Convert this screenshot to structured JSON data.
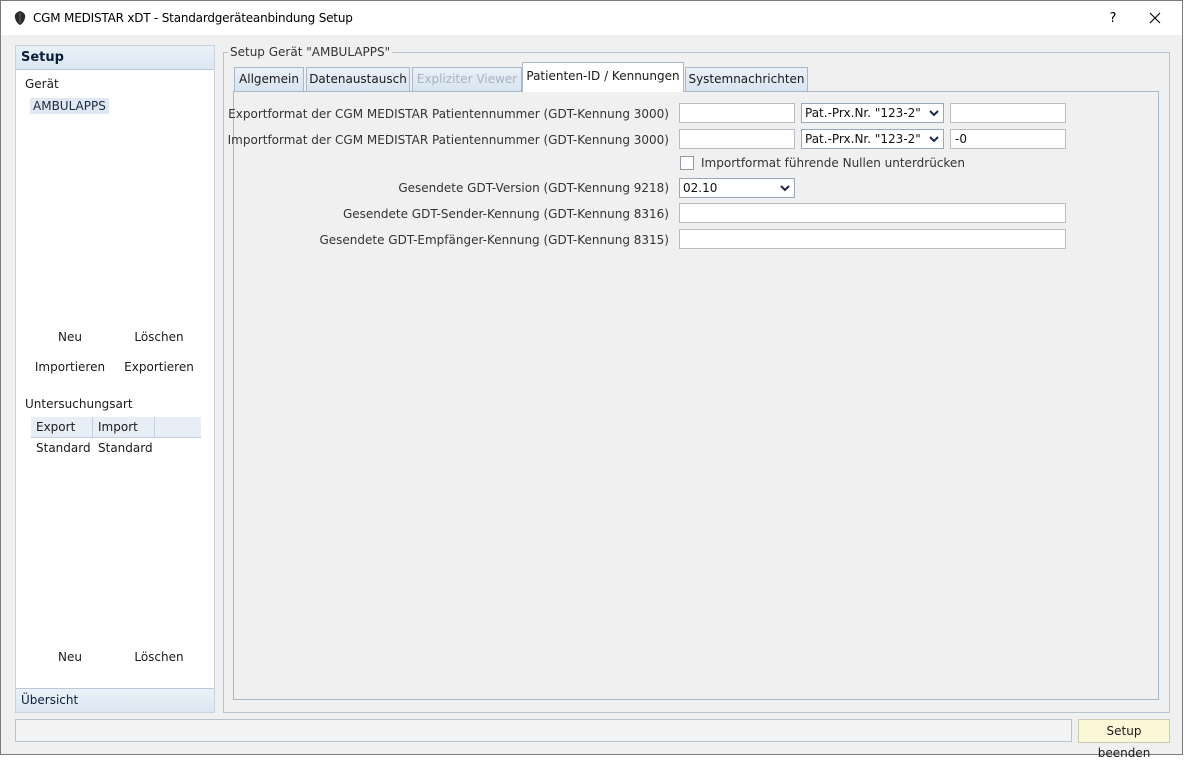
{
  "window": {
    "title": "CGM MEDISTAR xDT - Standardgeräteanbindung  Setup",
    "help_label": "?",
    "close_label": "✕"
  },
  "sidebar": {
    "header": "Setup",
    "device_section": "Gerät",
    "selected_device": "AMBULAPPS",
    "device_buttons": {
      "new": "Neu",
      "delete": "Löschen",
      "import": "Importieren",
      "export": "Exportieren"
    },
    "exam_section": "Untersuchungsart",
    "exam_table": {
      "columns": [
        "Export",
        "Import"
      ],
      "rows": [
        [
          "Standard",
          "Standard"
        ]
      ]
    },
    "exam_buttons": {
      "new": "Neu",
      "delete": "Löschen"
    },
    "footer": "Übersicht"
  },
  "main": {
    "group_title": "Setup Gerät \"AMBULAPPS\"",
    "tabs": [
      {
        "label": "Allgemein",
        "state": "normal"
      },
      {
        "label": "Datenaustausch",
        "state": "normal"
      },
      {
        "label": "Expliziter Viewer",
        "state": "disabled"
      },
      {
        "label": "Patienten-ID / Kennungen",
        "state": "active"
      },
      {
        "label": "Systemnachrichten",
        "state": "normal"
      }
    ],
    "form": {
      "export_label": "Exportformat der CGM MEDISTAR Patientennummer (GDT-Kennung 3000)",
      "export_prefix": "",
      "export_format": "Pat.-Prx.Nr. \"123-2\"",
      "export_suffix": "",
      "import_label": "Importformat der CGM MEDISTAR Patientennummer (GDT-Kennung 3000)",
      "import_prefix": "",
      "import_format": "Pat.-Prx.Nr. \"123-2\"",
      "import_suffix": "-0",
      "suppress_zeros_label": "Importformat führende Nullen unterdrücken",
      "gdt_version_label": "Gesendete GDT-Version (GDT-Kennung 9218)",
      "gdt_version": "02.10",
      "sender_label": "Gesendete GDT-Sender-Kennung (GDT-Kennung 8316)",
      "sender_value": "",
      "receiver_label": "Gesendete GDT-Empfänger-Kennung (GDT-Kennung 8315)",
      "receiver_value": ""
    }
  },
  "footer": {
    "status_text": "",
    "finish_label": "Setup beenden"
  },
  "colors": {
    "accent_header": "#dce7f2",
    "selection": "#dfe8f3",
    "finish_button": "#fcf7d6"
  }
}
